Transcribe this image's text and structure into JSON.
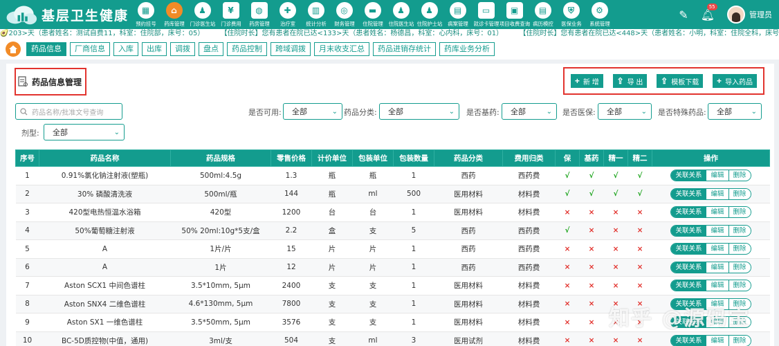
{
  "app": {
    "title": "基层卫生健康"
  },
  "nav": [
    {
      "label": "预约挂号",
      "icon": "calendar-icon"
    },
    {
      "label": "药库管理",
      "icon": "pharmacy-icon"
    },
    {
      "label": "门诊医生站",
      "icon": "doctor-icon"
    },
    {
      "label": "门诊费用",
      "icon": "yen-icon"
    },
    {
      "label": "药房管理",
      "icon": "pill-icon"
    },
    {
      "label": "治疗室",
      "icon": "treatment-icon"
    },
    {
      "label": "统计分析",
      "icon": "chart-icon"
    },
    {
      "label": "财务管理",
      "icon": "finance-icon"
    },
    {
      "label": "住院管理",
      "icon": "bed-icon"
    },
    {
      "label": "住院医生站",
      "icon": "doctor-icon"
    },
    {
      "label": "住院护士站",
      "icon": "nurse-icon"
    },
    {
      "label": "病案管理",
      "icon": "record-icon"
    },
    {
      "label": "就诊卡管理",
      "icon": "card-icon"
    },
    {
      "label": "项目收费查询",
      "icon": "search-doc-icon"
    },
    {
      "label": "病历模控",
      "icon": "book-icon"
    },
    {
      "label": "医保业务",
      "icon": "insurance-icon"
    },
    {
      "label": "系统管理",
      "icon": "gear-icon"
    }
  ],
  "header": {
    "badge": "55",
    "user": "管理员"
  },
  "marquee": [
    "🥑203>天（患者姓名：测试自费11，科室：住院部，床号：05）",
    "【住院时长】您有患者在院已达<133>天（患者姓名：杨德昌，科室：心内科，床号：01）",
    "【住院时长】您有患者在院已达<448>天（患者姓名：小明，科室：住院全科，床号："
  ],
  "tabs": [
    "药品信息",
    "厂商信息",
    "入库",
    "出库",
    "调拨",
    "盘点",
    "药品控制",
    "跨域调拨",
    "月末收支汇总",
    "药品进销存统计",
    "药库业务分析"
  ],
  "page": {
    "title": "药品信息管理"
  },
  "actions": {
    "add": "新 增",
    "export": "导 出",
    "template": "模板下载",
    "import": "导入药品"
  },
  "filters": {
    "search_placeholder": "药品名称/批准文号查询",
    "available_label": "是否可用:",
    "available_value": "全部",
    "category_label": "药品分类:",
    "category_value": "全部",
    "basic_label": "是否基药:",
    "basic_value": "全部",
    "insurance_label": "是否医保:",
    "insurance_value": "全部",
    "special_label": "是否特殊药品:",
    "special_value": "全部",
    "form_label": "剂型:",
    "form_value": "全部"
  },
  "table": {
    "headers": [
      "序号",
      "药品名称",
      "药品规格",
      "零售价格",
      "计价单位",
      "包装单位",
      "包装数量",
      "药品分类",
      "费用归类",
      "保",
      "基药",
      "精一",
      "精二",
      "操作"
    ],
    "rows": [
      [
        "1",
        "0.91%氯化钠注射液(塑瓶)",
        "500ml:4.5g",
        "1.3",
        "瓶",
        "瓶",
        "1",
        "西药",
        "西药费",
        "√",
        "√",
        "√",
        "√"
      ],
      [
        "2",
        "30% 磷酸清洗液",
        "500ml/瓶",
        "144",
        "瓶",
        "ml",
        "500",
        "医用材料",
        "材料费",
        "√",
        "√",
        "√",
        "√"
      ],
      [
        "3",
        "420型电热恒温水浴箱",
        "420型",
        "1200",
        "台",
        "台",
        "1",
        "医用材料",
        "材料费",
        "×",
        "×",
        "×",
        "×"
      ],
      [
        "4",
        "50%葡萄糖注射液",
        "50% 20ml:10g*5支/盒",
        "2.2",
        "盒",
        "支",
        "5",
        "西药",
        "西药费",
        "√",
        "×",
        "×",
        "×"
      ],
      [
        "5",
        "A",
        "1片/片",
        "15",
        "片",
        "片",
        "1",
        "西药",
        "西药费",
        "×",
        "×",
        "×",
        "×"
      ],
      [
        "6",
        "A",
        "1片",
        "12",
        "片",
        "片",
        "1",
        "西药",
        "西药费",
        "×",
        "×",
        "×",
        "×"
      ],
      [
        "7",
        "Aston SCX1 中间色谱柱",
        "3.5*10mm, 5μm",
        "2400",
        "支",
        "支",
        "1",
        "医用材料",
        "材料费",
        "×",
        "×",
        "×",
        "×"
      ],
      [
        "8",
        "Aston SNX4 二维色谱柱",
        "4.6*130mm, 5μm",
        "7800",
        "支",
        "支",
        "1",
        "医用材料",
        "材料费",
        "×",
        "×",
        "×",
        "×"
      ],
      [
        "9",
        "Aston SX1 一维色谱柱",
        "3.5*50mm, 5μm",
        "3576",
        "支",
        "支",
        "1",
        "医用材料",
        "材料费",
        "×",
        "×",
        "×",
        "×"
      ],
      [
        "10",
        "BC-5D质控物(中值，通用)",
        "3ml/支",
        "504",
        "支",
        "ml",
        "3",
        "医用试剂",
        "材料费",
        "×",
        "×",
        "×",
        "×"
      ]
    ],
    "ops": [
      "关联关系",
      "编辑",
      "删除"
    ]
  },
  "watermark": "知乎 @源码宝"
}
